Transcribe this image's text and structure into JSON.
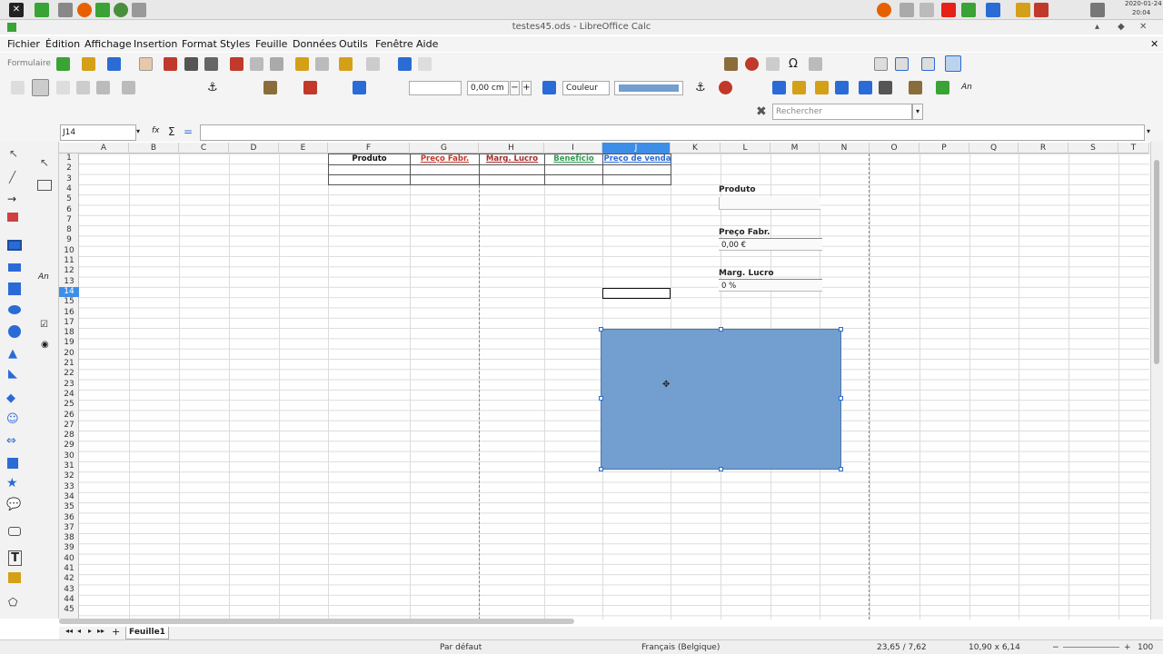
{
  "system": {
    "date": "2020-01-24",
    "time": "20:04"
  },
  "window": {
    "title": "testes45.ods - LibreOffice Calc"
  },
  "menu": [
    "Fichier",
    "Édition",
    "Affichage",
    "Insertion",
    "Format",
    "Styles",
    "Feuille",
    "Données",
    "Outils",
    "Fenêtre",
    "Aide"
  ],
  "toolbar": {
    "style_box": "Formulaire",
    "line_width": "0,00 cm",
    "area_fill": "Couleur",
    "find_placeholder": "Rechercher"
  },
  "formula": {
    "name_box": "J14",
    "content": ""
  },
  "columns": [
    "A",
    "B",
    "C",
    "D",
    "E",
    "F",
    "G",
    "H",
    "I",
    "J",
    "K",
    "L",
    "M",
    "N",
    "O",
    "P",
    "Q",
    "R",
    "S",
    "T"
  ],
  "rows": [
    "1",
    "2",
    "3",
    "4",
    "5",
    "6",
    "7",
    "8",
    "9",
    "10",
    "11",
    "12",
    "13",
    "14",
    "15",
    "16",
    "17",
    "18",
    "19",
    "20",
    "21",
    "22",
    "23",
    "24",
    "25",
    "26",
    "27",
    "28",
    "29",
    "30",
    "31",
    "32",
    "33",
    "34",
    "35",
    "36",
    "37",
    "38",
    "39",
    "40",
    "41",
    "42",
    "43",
    "44",
    "45"
  ],
  "table_headers": [
    {
      "label": "Produto",
      "color": "#111111"
    },
    {
      "label": "Preço Fabr.",
      "color": "#c0392b"
    },
    {
      "label": "Marg. Lucro",
      "color": "#a52a2a"
    },
    {
      "label": "Benefício",
      "color": "#2e9b4e"
    },
    {
      "label": "Preço de venda",
      "color": "#2a6bd6"
    }
  ],
  "form": {
    "produto_label": "Produto",
    "produto_value": "",
    "preco_label": "Preço Fabr.",
    "preco_value": "0,00 €",
    "marg_label": "Marg. Lucro",
    "marg_value": "0 %"
  },
  "sheet_tab": "Feuille1",
  "status": {
    "page_style": "Par défaut",
    "language": "Français (Belgique)",
    "position": "23,65 / 7,62",
    "size": "10,90 x 6,14",
    "zoom": "100 %"
  },
  "colors": {
    "shape_fill": "#729fcf",
    "selected_col": "#3d8ee6"
  }
}
